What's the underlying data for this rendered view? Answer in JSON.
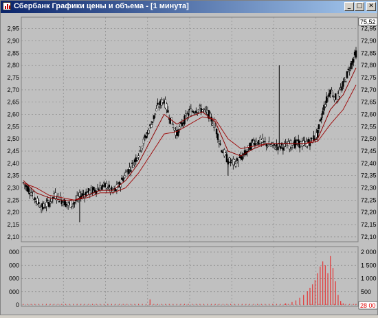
{
  "window": {
    "title": "Сбербанк Графики цены и объема - [1 минута]",
    "minimize_glyph": "_",
    "restore_glyph": "□",
    "close_glyph": "✕",
    "icon": "chart-icon"
  },
  "colors": {
    "background": "#c0c0c0",
    "grid": "#8a8a8a",
    "candle": "#000000",
    "ma_fast": "#8b0000",
    "ma_slow": "#a01010",
    "volume_bar": "#e04040",
    "current_price_box": "#ffffff",
    "current_volume_text": "#e00000"
  },
  "price_panel": {
    "left_ticks": [
      "2,95",
      "2,90",
      "2,85",
      "2,80",
      "2,75",
      "2,70",
      "2,65",
      "2,60",
      "2,55",
      "2,50",
      "2,45",
      "2,40",
      "2,35",
      "2,30",
      "2,25",
      "2,20",
      "2,15",
      "2,10"
    ],
    "right_ticks": [
      "72,95",
      "72,90",
      "72,85",
      "72,80",
      "72,75",
      "72,70",
      "72,65",
      "72,60",
      "72,55",
      "72,50",
      "72,45",
      "72,40",
      "72,35",
      "72,30",
      "72,25",
      "72,20",
      "72,15",
      "72,10"
    ],
    "current_price": "75,52"
  },
  "volume_panel": {
    "left_ticks": [
      "000",
      "000",
      "000",
      "000",
      "0"
    ],
    "right_ticks": [
      "2 000",
      "1 500",
      "1 000",
      "500",
      "0"
    ],
    "current_volume": "28 00"
  },
  "chart_data": [
    {
      "type": "candlestick",
      "title": "",
      "ylabel": "",
      "ylim": [
        72.08,
        72.98
      ],
      "grid": true,
      "price_points": [
        [
          0,
          72.32
        ],
        [
          5,
          72.29
        ],
        [
          10,
          72.25
        ],
        [
          15,
          72.22
        ],
        [
          20,
          72.24
        ],
        [
          25,
          72.27
        ],
        [
          30,
          72.25
        ],
        [
          35,
          72.23
        ],
        [
          40,
          72.24
        ],
        [
          45,
          72.27
        ],
        [
          50,
          72.28
        ],
        [
          55,
          72.29
        ],
        [
          60,
          72.3
        ],
        [
          65,
          72.31
        ],
        [
          70,
          72.28
        ],
        [
          75,
          72.31
        ],
        [
          80,
          72.36
        ],
        [
          85,
          72.39
        ],
        [
          90,
          72.44
        ],
        [
          95,
          72.5
        ],
        [
          100,
          72.56
        ],
        [
          105,
          72.63
        ],
        [
          110,
          72.66
        ],
        [
          115,
          72.58
        ],
        [
          120,
          72.52
        ],
        [
          125,
          72.57
        ],
        [
          130,
          72.61
        ],
        [
          135,
          72.62
        ],
        [
          140,
          72.62
        ],
        [
          145,
          72.6
        ],
        [
          150,
          72.55
        ],
        [
          155,
          72.46
        ],
        [
          160,
          72.41
        ],
        [
          165,
          72.4
        ],
        [
          170,
          72.42
        ],
        [
          175,
          72.45
        ],
        [
          180,
          72.49
        ],
        [
          185,
          72.49
        ],
        [
          190,
          72.48
        ],
        [
          195,
          72.47
        ],
        [
          200,
          72.47
        ],
        [
          205,
          72.47
        ],
        [
          210,
          72.48
        ],
        [
          215,
          72.48
        ],
        [
          220,
          72.48
        ],
        [
          225,
          72.49
        ],
        [
          230,
          72.52
        ],
        [
          235,
          72.63
        ],
        [
          240,
          72.7
        ],
        [
          245,
          72.66
        ],
        [
          250,
          72.72
        ],
        [
          255,
          72.79
        ],
        [
          260,
          72.85
        ]
      ],
      "ma_fast_points": [
        [
          0,
          72.33
        ],
        [
          10,
          72.28
        ],
        [
          20,
          72.26
        ],
        [
          30,
          72.25
        ],
        [
          40,
          72.25
        ],
        [
          50,
          72.27
        ],
        [
          60,
          72.29
        ],
        [
          70,
          72.29
        ],
        [
          80,
          72.33
        ],
        [
          90,
          72.4
        ],
        [
          100,
          72.5
        ],
        [
          110,
          72.6
        ],
        [
          120,
          72.56
        ],
        [
          130,
          72.59
        ],
        [
          140,
          72.61
        ],
        [
          150,
          72.57
        ],
        [
          160,
          72.45
        ],
        [
          170,
          72.43
        ],
        [
          180,
          72.46
        ],
        [
          190,
          72.48
        ],
        [
          200,
          72.48
        ],
        [
          210,
          72.48
        ],
        [
          220,
          72.48
        ],
        [
          230,
          72.5
        ],
        [
          240,
          72.62
        ],
        [
          250,
          72.68
        ],
        [
          260,
          72.79
        ]
      ],
      "ma_slow_points": [
        [
          0,
          72.32
        ],
        [
          10,
          72.3
        ],
        [
          20,
          72.27
        ],
        [
          30,
          72.26
        ],
        [
          40,
          72.25
        ],
        [
          50,
          72.26
        ],
        [
          60,
          72.28
        ],
        [
          70,
          72.28
        ],
        [
          80,
          72.3
        ],
        [
          90,
          72.36
        ],
        [
          100,
          72.44
        ],
        [
          110,
          72.52
        ],
        [
          120,
          72.53
        ],
        [
          130,
          72.56
        ],
        [
          140,
          72.59
        ],
        [
          150,
          72.58
        ],
        [
          160,
          72.5
        ],
        [
          170,
          72.46
        ],
        [
          180,
          72.47
        ],
        [
          190,
          72.48
        ],
        [
          200,
          72.48
        ],
        [
          210,
          72.48
        ],
        [
          220,
          72.48
        ],
        [
          230,
          72.49
        ],
        [
          240,
          72.56
        ],
        [
          250,
          72.62
        ],
        [
          260,
          72.72
        ]
      ],
      "spikes": [
        [
          200,
          72.8
        ],
        [
          160,
          72.35
        ],
        [
          44,
          72.16
        ]
      ]
    },
    {
      "type": "bar",
      "title": "",
      "ylabel": "",
      "ylim": [
        0,
        2000
      ],
      "grid": true,
      "values": [
        [
          99,
          210
        ],
        [
          195,
          40
        ],
        [
          205,
          60
        ],
        [
          210,
          110
        ],
        [
          213,
          170
        ],
        [
          216,
          270
        ],
        [
          219,
          380
        ],
        [
          222,
          520
        ],
        [
          224,
          650
        ],
        [
          226,
          780
        ],
        [
          228,
          940
        ],
        [
          230,
          1200
        ],
        [
          232,
          1450
        ],
        [
          234,
          1650
        ],
        [
          236,
          1500
        ],
        [
          238,
          1200
        ],
        [
          240,
          1850
        ],
        [
          242,
          1400
        ],
        [
          244,
          900
        ],
        [
          246,
          380
        ],
        [
          248,
          150
        ],
        [
          250,
          60
        ],
        [
          260,
          40
        ]
      ]
    }
  ]
}
